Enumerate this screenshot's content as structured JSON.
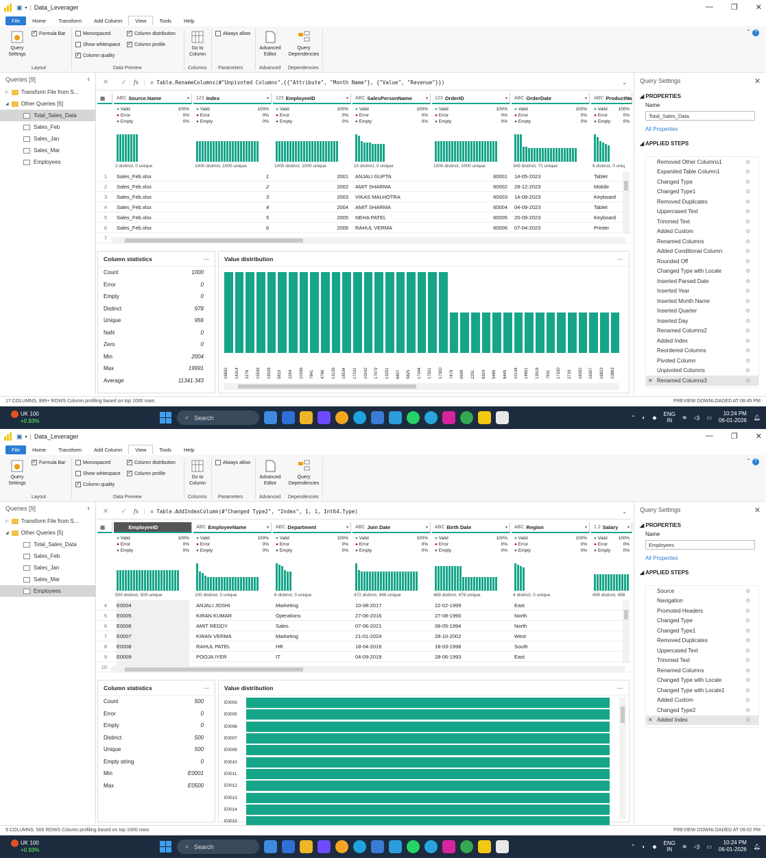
{
  "common": {
    "app_title": "Data_Leverager",
    "tabs": [
      "File",
      "Home",
      "Transform",
      "Add Column",
      "View",
      "Tools",
      "Help"
    ],
    "ribbon": {
      "formula_bar": "Formula Bar",
      "monospaced": "Monospaced",
      "show_whitespace": "Show whitespace",
      "column_quality": "Column quality",
      "column_distribution": "Column distribution",
      "column_profile": "Column profile",
      "always_allow": "Always allow",
      "query_settings": "Query Settings",
      "go_to_column": "Go to Column",
      "advanced_editor": "Advanced Editor",
      "query_dependencies": "Query Dependencies",
      "groups": [
        "Layout",
        "Data Preview",
        "Columns",
        "Parameters",
        "Advanced",
        "Dependencies"
      ]
    },
    "queries_title": "Queries [9]",
    "query_tree": {
      "transform_folder": "Transform File from S...",
      "other_folder": "Other Queries [5]",
      "items": [
        "Total_Sales_Data",
        "Sales_Feb",
        "Sales_Jan",
        "Sales_Mar",
        "Employees"
      ]
    },
    "query_settings_title": "Query Settings",
    "properties": "PROPERTIES",
    "name_label": "Name",
    "all_properties": "All Properties",
    "applied_steps": "APPLIED STEPS",
    "stat_title": "Column statistics",
    "dist_title": "Value distribution",
    "quality": {
      "valid": "Valid",
      "error": "Error",
      "empty": "Empty",
      "p100": "100%",
      "p0": "0%"
    },
    "taskbar": {
      "weather_title": "UK 100",
      "weather_sub": "+0.93%",
      "search": "Search",
      "lang1": "ENG",
      "lang2": "IN",
      "time": "10:24 PM",
      "date": "06-01-2026"
    }
  },
  "shotA": {
    "formula": "= Table.RenameColumns(#\"Unpivoted Columns\",{{\"Attribute\", \"Month Name\"}, {\"Value\", \"Revenue\"}})",
    "selected_query": "Total_Sales_Data",
    "query_name": "Total_Sales_Data",
    "columns": [
      {
        "type": "ABC",
        "name": "Source.Name",
        "distinct": "2 distinct, 0 unique"
      },
      {
        "type": "123",
        "name": "Index",
        "distinct": "1000 distinct, 1000 unique"
      },
      {
        "type": "123",
        "name": "EmployeeID",
        "distinct": "1000 distinct, 1000 unique"
      },
      {
        "type": "ABC",
        "name": "SalesPersonName",
        "distinct": "10 distinct, 0 unique"
      },
      {
        "type": "123",
        "name": "OrderID",
        "distinct": "1000 distinct, 1000 unique"
      },
      {
        "type": "ABC",
        "name": "OrderDate",
        "distinct": "349 distinct, 71 unique"
      },
      {
        "type": "ABC",
        "name": "ProductNam",
        "distinct": "6 distinct, 0 uniq"
      }
    ],
    "rows": [
      [
        "1",
        "Sales_Feb.xlsx",
        "1",
        "2001",
        "ANJALI GUPTA",
        "60001",
        "14-05-2023",
        "Tablet"
      ],
      [
        "2",
        "Sales_Feb.xlsx",
        "2",
        "2002",
        "AMIT SHARMA",
        "60002",
        "28-12-2023",
        "Mobile"
      ],
      [
        "3",
        "Sales_Feb.xlsx",
        "3",
        "2003",
        "VIKAS MALHOTRA",
        "60003",
        "14-08-2023",
        "Keyboard"
      ],
      [
        "4",
        "Sales_Feb.xlsx",
        "4",
        "2004",
        "AMIT SHARMA",
        "60004",
        "04-09-2023",
        "Tablet"
      ],
      [
        "5",
        "Sales_Feb.xlsx",
        "5",
        "2005",
        "NEHA PATEL",
        "60005",
        "20-09-2023",
        "Keyboard"
      ],
      [
        "6",
        "Sales_Feb.xlsx",
        "6",
        "2006",
        "RAHUL VERMA",
        "60006",
        "07-04-2023",
        "Printer"
      ],
      [
        "7",
        "",
        "",
        "",
        "",
        "",
        "",
        ""
      ]
    ],
    "stats": [
      {
        "label": "Count",
        "value": "1000"
      },
      {
        "label": "Error",
        "value": "0"
      },
      {
        "label": "Empty",
        "value": "0"
      },
      {
        "label": "Distinct",
        "value": "978"
      },
      {
        "label": "Unique",
        "value": "956"
      },
      {
        "label": "NaN",
        "value": "0"
      },
      {
        "label": "Zero",
        "value": "0"
      },
      {
        "label": "Min",
        "value": "2004"
      },
      {
        "label": "Max",
        "value": "19991"
      },
      {
        "label": "Average",
        "value": "11341.343"
      }
    ],
    "dist_labels": [
      "16692",
      "14314",
      "2276",
      "15539",
      "19028",
      "5815",
      "2294",
      "10336",
      "7841",
      "4766",
      "13135",
      "18534",
      "17031",
      "10242",
      "17479",
      "13291",
      "6807",
      "5825",
      "17344",
      "17501",
      "17300",
      "7479",
      "9999",
      "2251",
      "8324",
      "5485",
      "8449",
      "10134",
      "14891",
      "13918",
      "7931",
      "17330",
      "2733",
      "16092",
      "16307",
      "16823",
      "10863"
    ],
    "dist_values": [
      2,
      2,
      2,
      2,
      2,
      2,
      2,
      2,
      2,
      2,
      2,
      2,
      2,
      2,
      2,
      2,
      2,
      2,
      2,
      2,
      2,
      1,
      1,
      1,
      1,
      1,
      1,
      1,
      1,
      1,
      1,
      1,
      1,
      1,
      1,
      1,
      1
    ],
    "steps": [
      "Removed Other Columns1",
      "Expanded Table Column1",
      "Changed Type",
      "Changed Type1",
      "Removed Duplicates",
      "Uppercased Text",
      "Trimmed Text",
      "Added Custom",
      "Renamed Columns",
      "Added Conditional Column",
      "Rounded Off",
      "Changed Type with Locale",
      "Inserted Parsed Date",
      "Inserted Year",
      "Inserted Month Name",
      "Inserted Quarter",
      "Inserted Day",
      "Renamed Columns2",
      "Added Index",
      "Reordered Columns",
      "Pivoted Column",
      "Unpivoted Columns",
      "Renamed Columns3"
    ],
    "status_left": "17 COLUMNS, 999+ ROWS    Column profiling based on top 1000 rows",
    "status_right": "PREVIEW DOWNLOADED AT 08:45 PM"
  },
  "shotB": {
    "formula": "= Table.AddIndexColumn(#\"Changed Type2\", \"Index\", 1, 1, Int64.Type)",
    "selected_query": "Employees",
    "query_name": "Employees",
    "columns": [
      {
        "type": "ABC",
        "name": "EmployeeID",
        "distinct": "500 distinct, 500 unique"
      },
      {
        "type": "ABC",
        "name": "EmployeeName",
        "distinct": "100 distinct, 0 unique"
      },
      {
        "type": "ABC",
        "name": "Department",
        "distinct": "6 distinct, 0 unique"
      },
      {
        "type": "ABC",
        "name": "Join Date",
        "distinct": "472 distinct, 446 unique"
      },
      {
        "type": "ABC",
        "name": "Birth Date",
        "distinct": "489 distinct, 478 unique"
      },
      {
        "type": "ABC",
        "name": "Region",
        "distinct": "4 distinct, 0 unique"
      },
      {
        "type": "1.2",
        "name": "Salary",
        "distinct": "499 distinct, 498"
      }
    ],
    "rows": [
      [
        "4",
        "E0004",
        "ANJALI JOSHI",
        "Marketing",
        "10-08-2017",
        "22-02-1999",
        "East",
        ""
      ],
      [
        "5",
        "E0005",
        "KIRAN KUMAR",
        "Operations",
        "27-06-2016",
        "27-08-1990",
        "North",
        ""
      ],
      [
        "6",
        "E0006",
        "AMIT REDDY",
        "Sales",
        "07-06-2021",
        "08-05-1994",
        "North",
        ""
      ],
      [
        "7",
        "E0007",
        "KIRAN VERMA",
        "Marketing",
        "21-01-2024",
        "28-10-2002",
        "West",
        ""
      ],
      [
        "8",
        "E0008",
        "RAHUL PATEL",
        "HR",
        "18-04-2016",
        "18-03-1998",
        "South",
        ""
      ],
      [
        "9",
        "E0009",
        "POOJA IYER",
        "IT",
        "04-09-2019",
        "28-06-1993",
        "East",
        ""
      ],
      [
        "10",
        "",
        "",
        "",
        "",
        "",
        "",
        ""
      ]
    ],
    "stats": [
      {
        "label": "Count",
        "value": "500"
      },
      {
        "label": "Error",
        "value": "0"
      },
      {
        "label": "Empty",
        "value": "0"
      },
      {
        "label": "Distinct",
        "value": "500"
      },
      {
        "label": "Unique",
        "value": "500"
      },
      {
        "label": "Empty string",
        "value": "0"
      },
      {
        "label": "Min",
        "value": "E0001"
      },
      {
        "label": "Max",
        "value": "E0500"
      }
    ],
    "dist_labels": [
      "E0003",
      "E0005",
      "E0006",
      "E0007",
      "E0009",
      "E0010",
      "E0011",
      "E0012",
      "E0013",
      "E0014",
      "E0015"
    ],
    "dist_values": [
      1,
      1,
      1,
      1,
      1,
      1,
      1,
      1,
      1,
      1,
      1
    ],
    "steps": [
      "Source",
      "Navigation",
      "Promoted Headers",
      "Changed Type",
      "Changed Type1",
      "Removed Duplicates",
      "Uppercased Text",
      "Trimmed Text",
      "Renamed Columns",
      "Changed Type with Locale",
      "Changed Type with Locale1",
      "Added Custom",
      "Changed Type2",
      "Added Index"
    ],
    "status_left": "9 COLUMNS, 500 ROWS    Column profiling based on top 1000 rows",
    "status_right": "PREVIEW DOWNLOADED AT 09:02 PM"
  },
  "colors": {
    "accent": "#17a589",
    "file_tab": "#2b7cd3"
  }
}
